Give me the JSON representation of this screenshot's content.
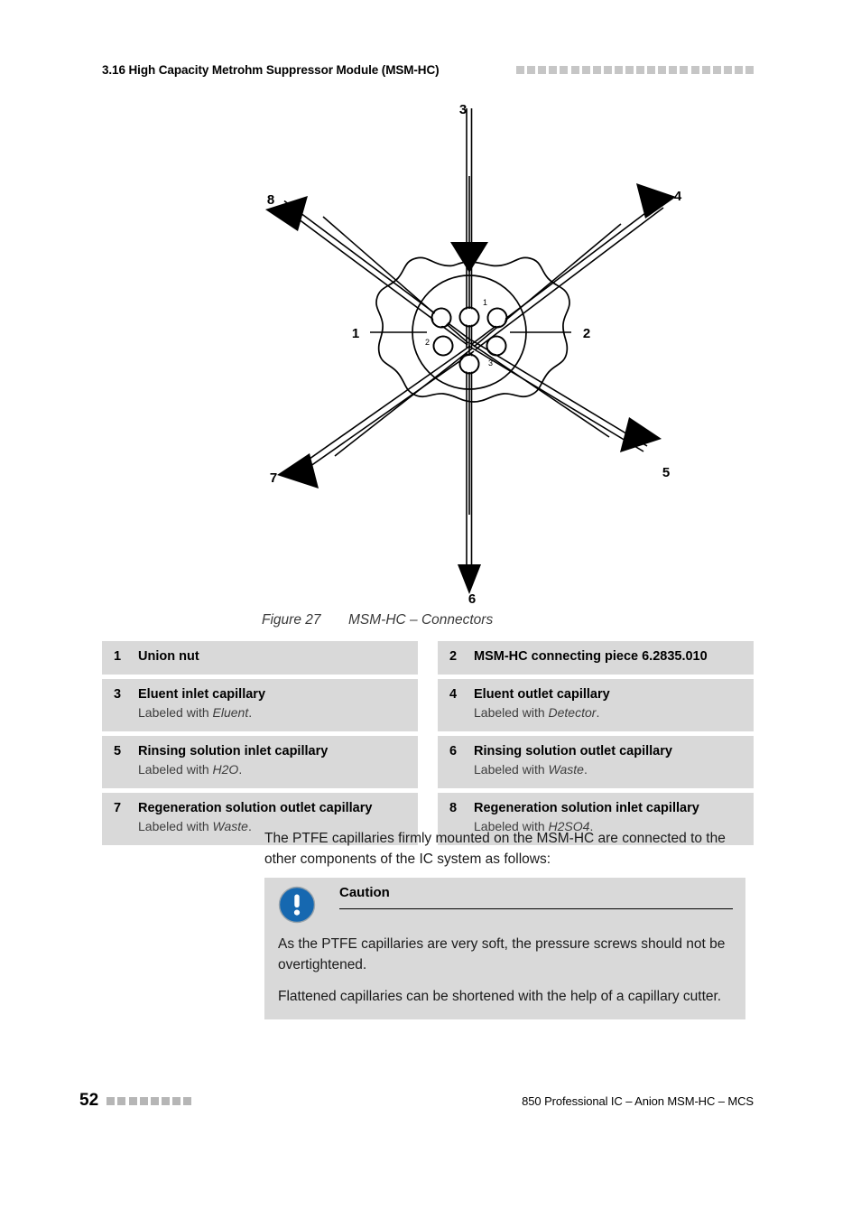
{
  "header": {
    "section_title": "3.16 High Capacity Metrohm Suppressor Module (MSM-HC)",
    "decor_squares": 22
  },
  "figure": {
    "callouts": [
      {
        "id": "3",
        "label": "3"
      },
      {
        "id": "4",
        "label": "4"
      },
      {
        "id": "8",
        "label": "8"
      },
      {
        "id": "1",
        "label": "1"
      },
      {
        "id": "2",
        "label": "2"
      },
      {
        "id": "7",
        "label": "7"
      },
      {
        "id": "5",
        "label": "5"
      },
      {
        "id": "6",
        "label": "6"
      }
    ],
    "port_numbers": [
      "1",
      "2",
      "3"
    ],
    "caption_number": "Figure 27",
    "caption_text": "MSM-HC – Connectors"
  },
  "legend": {
    "left_column": [
      {
        "num": "1",
        "label": "Union nut",
        "sub_prefix": "",
        "sub_italic": "",
        "sub_suffix": ""
      },
      {
        "num": "3",
        "label": "Eluent inlet capillary",
        "sub_prefix": "Labeled with ",
        "sub_italic": "Eluent",
        "sub_suffix": "."
      },
      {
        "num": "5",
        "label": "Rinsing solution inlet capillary",
        "sub_prefix": "Labeled with ",
        "sub_italic": "H2O",
        "sub_suffix": "."
      },
      {
        "num": "7",
        "label": "Regeneration solution outlet capillary",
        "sub_prefix": "Labeled with ",
        "sub_italic": "Waste",
        "sub_suffix": "."
      }
    ],
    "right_column": [
      {
        "num": "2",
        "label": "MSM-HC connecting piece 6.2835.010",
        "sub_prefix": "",
        "sub_italic": "",
        "sub_suffix": ""
      },
      {
        "num": "4",
        "label": "Eluent outlet capillary",
        "sub_prefix": "Labeled with ",
        "sub_italic": "Detector",
        "sub_suffix": "."
      },
      {
        "num": "6",
        "label": "Rinsing solution outlet capillary",
        "sub_prefix": "Labeled with ",
        "sub_italic": "Waste",
        "sub_suffix": "."
      },
      {
        "num": "8",
        "label": "Regeneration solution inlet capillary",
        "sub_prefix": "Labeled with ",
        "sub_italic": "H2SO4",
        "sub_suffix": "."
      }
    ]
  },
  "body": {
    "paragraph": "The PTFE capillaries firmly mounted on the MSM-HC are connected to the other components of the IC system as follows:"
  },
  "caution": {
    "title": "Caution",
    "paragraph_1": "As the PTFE capillaries are very soft, the pressure screws should not be overtightened.",
    "paragraph_2": "Flattened capillaries can be shortened with the help of a capillary cutter.",
    "icon_color": "#1668b0",
    "background": "#d9d9d9"
  },
  "footer": {
    "page_number": "52",
    "decor_squares": 8,
    "document_title": "850 Professional IC – Anion MSM-HC – MCS"
  }
}
